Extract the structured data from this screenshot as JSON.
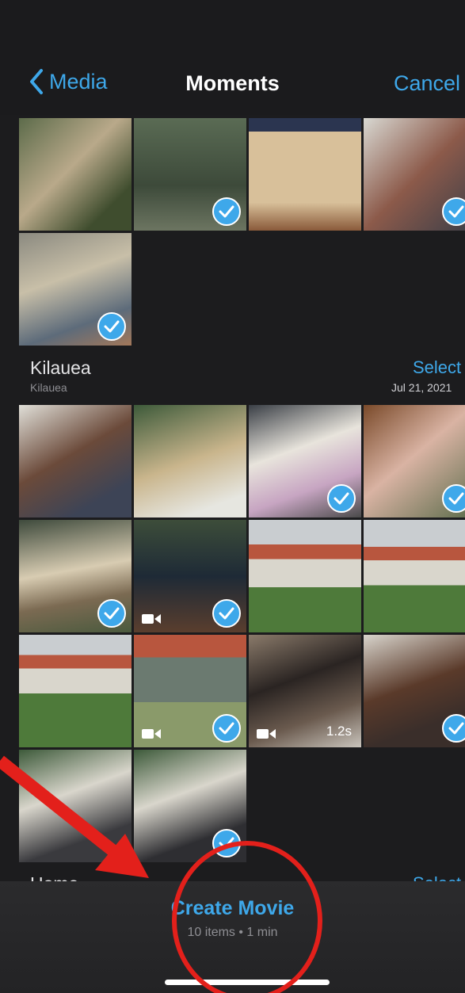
{
  "nav": {
    "back_label": "Media",
    "title": "Moments",
    "cancel_label": "Cancel"
  },
  "sections": [
    {
      "title": "Kilauea",
      "subtitle": "Kilauea",
      "select_label": "Select",
      "date": "Jul 21, 2021"
    },
    {
      "title": "Home",
      "select_label": "Select"
    }
  ],
  "tiles": [
    {
      "checked": false,
      "video": false
    },
    {
      "checked": true,
      "video": false
    },
    {
      "checked": false,
      "video": false
    },
    {
      "checked": true,
      "video": false
    },
    {
      "checked": true,
      "video": false
    },
    {
      "checked": false,
      "video": false
    },
    {
      "checked": false,
      "video": false
    },
    {
      "checked": true,
      "video": false
    },
    {
      "checked": true,
      "video": false
    },
    {
      "checked": true,
      "video": false
    },
    {
      "checked": true,
      "video": true
    },
    {
      "checked": false,
      "video": false
    },
    {
      "checked": false,
      "video": false
    },
    {
      "checked": false,
      "video": false
    },
    {
      "checked": true,
      "video": true
    },
    {
      "checked": false,
      "video": true,
      "duration": "1.2s"
    },
    {
      "checked": true,
      "video": false
    },
    {
      "checked": false,
      "video": false
    },
    {
      "checked": true,
      "video": false
    }
  ],
  "bottom": {
    "create_label": "Create Movie",
    "meta": "10 items • 1 min"
  },
  "colors": {
    "accent": "#3ea8ea",
    "annotation": "#e3201b"
  }
}
